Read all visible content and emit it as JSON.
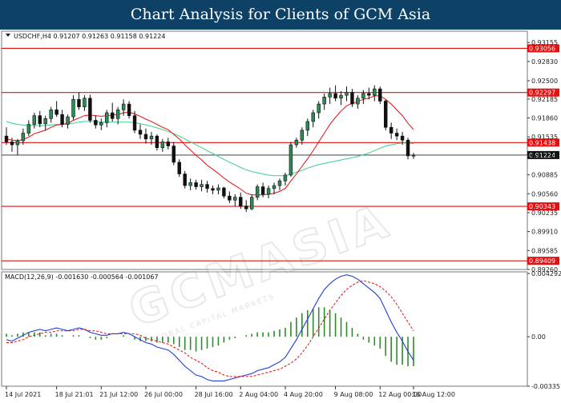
{
  "banner": {
    "title": "Chart Analysis for Clients of GCM Asia"
  },
  "watermark": {
    "text": "GCMASIA",
    "subtext": "GLOBAL CAPITAL MARKETS"
  },
  "chart_data": [
    {
      "type": "candlestick",
      "title": "USDCHF,H4  0.91207 0.91263 0.91158 0.91224",
      "ylim": [
        0.8926,
        0.9335
      ],
      "yticks": [
        "0.93155",
        "0.92830",
        "0.92500",
        "0.92185",
        "0.91860",
        "0.91535",
        "0.91210",
        "0.90885",
        "0.90560",
        "0.90235",
        "0.89910",
        "0.89585",
        "0.89260"
      ],
      "horizontal_levels": [
        {
          "value": 0.93056,
          "label": "0.93056",
          "color": "#e31010"
        },
        {
          "value": 0.92297,
          "label": "0.92297",
          "color": "#e31010"
        },
        {
          "value": 0.91438,
          "label": "0.91438",
          "color": "#e31010"
        },
        {
          "value": 0.91224,
          "label": "0.91224",
          "color": "#555555"
        },
        {
          "value": 0.90343,
          "label": "0.90343",
          "color": "#e31010"
        },
        {
          "value": 0.89409,
          "label": "0.89409",
          "color": "#e31010"
        }
      ],
      "candles": [
        [
          0.9155,
          0.917,
          0.914,
          0.9145
        ],
        [
          0.9145,
          0.9152,
          0.9128,
          0.914
        ],
        [
          0.914,
          0.915,
          0.9122,
          0.9147
        ],
        [
          0.9147,
          0.9168,
          0.914,
          0.916
        ],
        [
          0.916,
          0.9182,
          0.9155,
          0.9175
        ],
        [
          0.9175,
          0.9195,
          0.9168,
          0.919
        ],
        [
          0.919,
          0.9198,
          0.917,
          0.9176
        ],
        [
          0.9176,
          0.919,
          0.9165,
          0.9185
        ],
        [
          0.9185,
          0.9205,
          0.9178,
          0.92
        ],
        [
          0.92,
          0.9215,
          0.9188,
          0.9192
        ],
        [
          0.9192,
          0.92,
          0.917,
          0.9175
        ],
        [
          0.9175,
          0.9192,
          0.9168,
          0.9188
        ],
        [
          0.9188,
          0.9225,
          0.9183,
          0.9218
        ],
        [
          0.9218,
          0.923,
          0.92,
          0.9205
        ],
        [
          0.9205,
          0.9225,
          0.9198,
          0.922
        ],
        [
          0.922,
          0.9226,
          0.9178,
          0.9182
        ],
        [
          0.9182,
          0.919,
          0.9168,
          0.9174
        ],
        [
          0.9174,
          0.9185,
          0.9165,
          0.9178
        ],
        [
          0.9178,
          0.92,
          0.917,
          0.9195
        ],
        [
          0.9195,
          0.9212,
          0.918,
          0.9185
        ],
        [
          0.9185,
          0.9205,
          0.9175,
          0.92
        ],
        [
          0.92,
          0.9218,
          0.919,
          0.921
        ],
        [
          0.921,
          0.9215,
          0.9185,
          0.919
        ],
        [
          0.919,
          0.9198,
          0.916,
          0.9165
        ],
        [
          0.9165,
          0.9175,
          0.915,
          0.9158
        ],
        [
          0.9158,
          0.9168,
          0.9142,
          0.915
        ],
        [
          0.915,
          0.9162,
          0.914,
          0.9155
        ],
        [
          0.9155,
          0.9158,
          0.913,
          0.9135
        ],
        [
          0.9135,
          0.915,
          0.9128,
          0.9145
        ],
        [
          0.9145,
          0.9152,
          0.9132,
          0.9138
        ],
        [
          0.9138,
          0.9145,
          0.9105,
          0.911
        ],
        [
          0.911,
          0.9115,
          0.9085,
          0.909
        ],
        [
          0.909,
          0.9095,
          0.9065,
          0.907
        ],
        [
          0.907,
          0.9082,
          0.9062,
          0.9075
        ],
        [
          0.9075,
          0.908,
          0.9063,
          0.9068
        ],
        [
          0.9068,
          0.908,
          0.906,
          0.9072
        ],
        [
          0.9072,
          0.9078,
          0.9058,
          0.9065
        ],
        [
          0.9065,
          0.907,
          0.9055,
          0.9062
        ],
        [
          0.9062,
          0.9072,
          0.9055,
          0.9066
        ],
        [
          0.9066,
          0.9068,
          0.9048,
          0.9052
        ],
        [
          0.9052,
          0.906,
          0.904,
          0.9045
        ],
        [
          0.9045,
          0.9055,
          0.9035,
          0.905
        ],
        [
          0.905,
          0.9058,
          0.903,
          0.9035
        ],
        [
          0.9035,
          0.9045,
          0.9025,
          0.903
        ],
        [
          0.903,
          0.9055,
          0.9028,
          0.905
        ],
        [
          0.905,
          0.9072,
          0.9045,
          0.9068
        ],
        [
          0.9068,
          0.9075,
          0.905,
          0.9055
        ],
        [
          0.9055,
          0.907,
          0.9048,
          0.9065
        ],
        [
          0.9065,
          0.9075,
          0.9055,
          0.907
        ],
        [
          0.907,
          0.9082,
          0.9062,
          0.9078
        ],
        [
          0.9078,
          0.9092,
          0.907,
          0.9088
        ],
        [
          0.9088,
          0.9145,
          0.9085,
          0.914
        ],
        [
          0.914,
          0.9152,
          0.9135,
          0.9148
        ],
        [
          0.9148,
          0.917,
          0.914,
          0.9165
        ],
        [
          0.9165,
          0.9185,
          0.9155,
          0.918
        ],
        [
          0.918,
          0.92,
          0.917,
          0.9195
        ],
        [
          0.9195,
          0.9215,
          0.9185,
          0.921
        ],
        [
          0.921,
          0.9228,
          0.92,
          0.9222
        ],
        [
          0.9222,
          0.9238,
          0.921,
          0.9228
        ],
        [
          0.9228,
          0.9242,
          0.9215,
          0.922
        ],
        [
          0.922,
          0.9232,
          0.9208,
          0.9225
        ],
        [
          0.9225,
          0.924,
          0.9215,
          0.923
        ],
        [
          0.923,
          0.9236,
          0.9205,
          0.921
        ],
        [
          0.921,
          0.9225,
          0.9202,
          0.922
        ],
        [
          0.922,
          0.9234,
          0.921,
          0.9228
        ],
        [
          0.9228,
          0.9238,
          0.9218,
          0.9225
        ],
        [
          0.9225,
          0.9242,
          0.9215,
          0.9236
        ],
        [
          0.9236,
          0.924,
          0.921,
          0.9215
        ],
        [
          0.9215,
          0.9218,
          0.9165,
          0.917
        ],
        [
          0.917,
          0.9178,
          0.915,
          0.916
        ],
        [
          0.916,
          0.9168,
          0.9148,
          0.9155
        ],
        [
          0.9155,
          0.9162,
          0.914,
          0.9148
        ],
        [
          0.9148,
          0.9152,
          0.9115,
          0.9121
        ],
        [
          0.9121,
          0.9126,
          0.9116,
          0.9122
        ]
      ],
      "ma_red": [
        0.915,
        0.9148,
        0.9147,
        0.9149,
        0.9153,
        0.9159,
        0.9162,
        0.9165,
        0.917,
        0.9174,
        0.9175,
        0.9177,
        0.9182,
        0.9186,
        0.919,
        0.9191,
        0.919,
        0.9189,
        0.919,
        0.9191,
        0.9192,
        0.9195,
        0.9196,
        0.9193,
        0.9189,
        0.9184,
        0.918,
        0.9175,
        0.917,
        0.9166,
        0.9158,
        0.915,
        0.914,
        0.9131,
        0.9122,
        0.9114,
        0.9105,
        0.9098,
        0.9091,
        0.9083,
        0.9076,
        0.907,
        0.9064,
        0.9057,
        0.9054,
        0.9054,
        0.9054,
        0.9055,
        0.9057,
        0.906,
        0.9065,
        0.9078,
        0.909,
        0.9103,
        0.9116,
        0.913,
        0.9145,
        0.916,
        0.9175,
        0.9187,
        0.9198,
        0.9207,
        0.9211,
        0.9214,
        0.9218,
        0.922,
        0.9224,
        0.9224,
        0.9218,
        0.921,
        0.92,
        0.919,
        0.9177,
        0.9166
      ],
      "ma_green": [
        0.918,
        0.9177,
        0.9175,
        0.9174,
        0.9173,
        0.9173,
        0.9173,
        0.9173,
        0.9174,
        0.9175,
        0.9175,
        0.9176,
        0.9177,
        0.9179,
        0.918,
        0.918,
        0.918,
        0.9179,
        0.9179,
        0.9179,
        0.9179,
        0.9179,
        0.9179,
        0.9178,
        0.9176,
        0.9174,
        0.9172,
        0.9169,
        0.9166,
        0.9163,
        0.9159,
        0.9155,
        0.915,
        0.9145,
        0.914,
        0.9135,
        0.913,
        0.9125,
        0.912,
        0.9115,
        0.911,
        0.9106,
        0.9101,
        0.9097,
        0.9094,
        0.9092,
        0.909,
        0.9088,
        0.9087,
        0.9087,
        0.9087,
        0.909,
        0.9093,
        0.9096,
        0.91,
        0.9103,
        0.9106,
        0.9108,
        0.911,
        0.9112,
        0.9114,
        0.9116,
        0.9118,
        0.912,
        0.9123,
        0.9126,
        0.913,
        0.9134,
        0.9138,
        0.914,
        0.9142,
        0.9143,
        0.9143,
        0.9142
      ],
      "x_labels": [
        "14 Jul 2021",
        "18 Jul 21:01",
        "21 Jul 12:00",
        "26 Jul 00:00",
        "28 Jul 16:00",
        "2 Aug 04:00",
        "4 Aug 20:00",
        "9 Aug 08:00",
        "12 Aug 00:00",
        "16 Aug 12:00"
      ],
      "xlabel_positions_index": [
        0,
        9,
        17,
        25,
        34,
        42,
        50,
        59,
        67,
        76
      ]
    },
    {
      "type": "macd",
      "title": "MACD(12,26,9) -0.001630 -0.000564 -0.001067",
      "ylim": [
        -0.003357,
        0.004292
      ],
      "yticks": [
        "0.004292",
        "0.00",
        "-0.003357"
      ],
      "macd_line": [
        -0.0002,
        -0.0003,
        -0.0001,
        0.0001,
        0.0003,
        0.0004,
        0.0005,
        0.0004,
        0.0005,
        0.0006,
        0.0005,
        0.0004,
        0.0005,
        0.0006,
        0.0005,
        0.0003,
        0.0002,
        0.0001,
        0.0001,
        0.0002,
        0.0002,
        0.0003,
        0.0002,
        0.0,
        -0.0002,
        -0.0004,
        -0.0005,
        -0.0007,
        -0.0008,
        -0.0009,
        -0.0012,
        -0.0016,
        -0.002,
        -0.0023,
        -0.0026,
        -0.0027,
        -0.0029,
        -0.003,
        -0.003,
        -0.003,
        -0.0029,
        -0.0028,
        -0.0027,
        -0.0026,
        -0.0025,
        -0.0023,
        -0.0022,
        -0.0021,
        -0.0019,
        -0.0017,
        -0.0014,
        -0.0008,
        -0.0002,
        0.0005,
        0.0012,
        0.0019,
        0.0026,
        0.0032,
        0.0036,
        0.0039,
        0.0041,
        0.0042,
        0.0041,
        0.0039,
        0.0036,
        0.0033,
        0.003,
        0.0026,
        0.0018,
        0.001,
        0.0003,
        -0.0003,
        -0.001,
        -0.0016
      ],
      "signal_line": [
        -0.0004,
        -0.0004,
        -0.0003,
        -0.0002,
        0.0,
        0.0001,
        0.0002,
        0.0003,
        0.0003,
        0.0004,
        0.0004,
        0.0004,
        0.0004,
        0.0005,
        0.0005,
        0.0004,
        0.0004,
        0.0003,
        0.0002,
        0.0002,
        0.0002,
        0.0002,
        0.0002,
        0.0002,
        0.0001,
        -0.0001,
        -0.0002,
        -0.0003,
        -0.0004,
        -0.0005,
        -0.0007,
        -0.0009,
        -0.0011,
        -0.0014,
        -0.0016,
        -0.0018,
        -0.0021,
        -0.0023,
        -0.0024,
        -0.0026,
        -0.0027,
        -0.0027,
        -0.0027,
        -0.0027,
        -0.0027,
        -0.0026,
        -0.0025,
        -0.0024,
        -0.0023,
        -0.0022,
        -0.002,
        -0.0018,
        -0.0015,
        -0.0011,
        -0.0006,
        0.0,
        0.0006,
        0.0012,
        0.0018,
        0.0023,
        0.0028,
        0.0032,
        0.0035,
        0.0037,
        0.0038,
        0.0037,
        0.0036,
        0.0034,
        0.0031,
        0.0027,
        0.0022,
        0.0016,
        0.001,
        0.0004
      ],
      "bar_color": "#2e8b2e",
      "macd_color": "#1f3fd6",
      "signal_color": "#e31010"
    }
  ]
}
